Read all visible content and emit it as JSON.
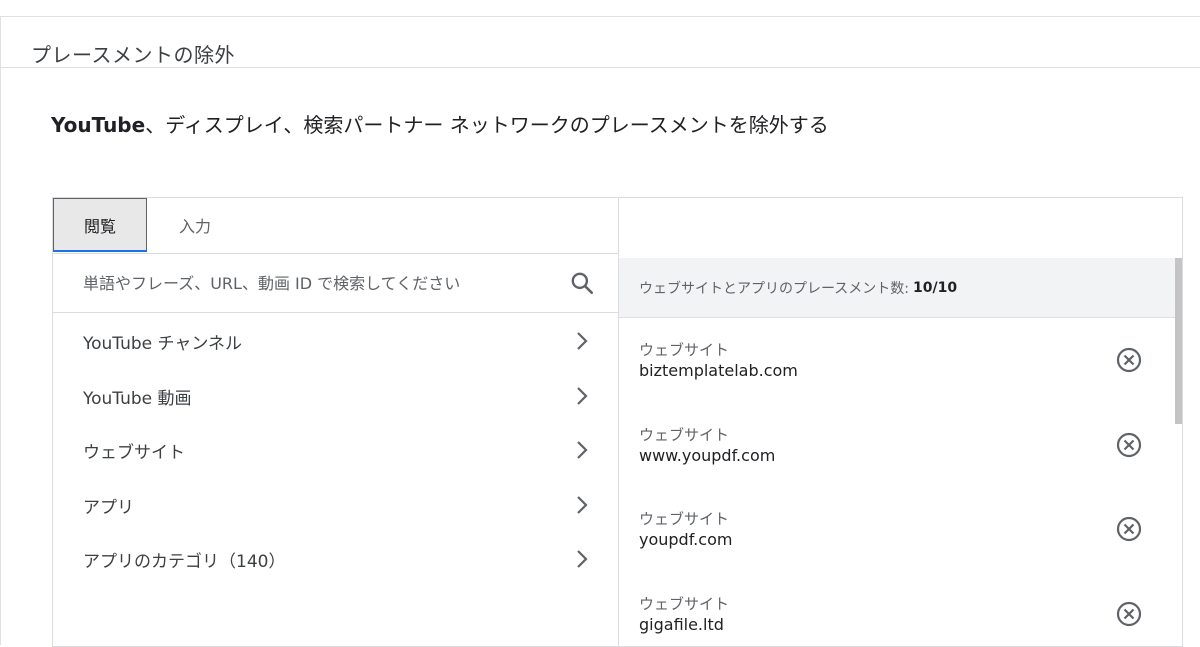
{
  "section": {
    "title": "プレースメントの除外"
  },
  "description": {
    "brand": "YouTube",
    "text": "、ディスプレイ、検索パートナー ネットワークのプレースメントを除外する"
  },
  "tabs": [
    {
      "label": "閲覧",
      "selected": true
    },
    {
      "label": "入力",
      "selected": false
    }
  ],
  "search": {
    "placeholder": "単語やフレーズ、URL、動画 ID で検索してください",
    "value": "",
    "icon": "search-icon"
  },
  "nav_items": [
    {
      "label": "YouTube チャンネル",
      "icon": "chevron-right-icon"
    },
    {
      "label": "YouTube 動画",
      "icon": "chevron-right-icon"
    },
    {
      "label": "ウェブサイト",
      "icon": "chevron-right-icon"
    },
    {
      "label": "アプリ",
      "icon": "chevron-right-icon"
    },
    {
      "label": "アプリのカテゴリ（140）",
      "icon": "chevron-right-icon"
    }
  ],
  "selected_panel": {
    "count_label": "ウェブサイトとアプリのプレースメント数:",
    "count_value": "10/10",
    "items": [
      {
        "type": "ウェブサイト",
        "url": "biztemplatelab.com",
        "icon": "remove-circle-icon"
      },
      {
        "type": "ウェブサイト",
        "url": "www.youpdf.com",
        "icon": "remove-circle-icon"
      },
      {
        "type": "ウェブサイト",
        "url": "youpdf.com",
        "icon": "remove-circle-icon"
      },
      {
        "type": "ウェブサイト",
        "url": "gigafile.ltd",
        "icon": "remove-circle-icon"
      }
    ]
  },
  "colors": {
    "accent": "#1a73e8",
    "tab_selected_bg": "#e8e8e8",
    "count_bar_bg": "#f1f3f4",
    "border": "#dadce0",
    "icon": "#5f6368"
  }
}
